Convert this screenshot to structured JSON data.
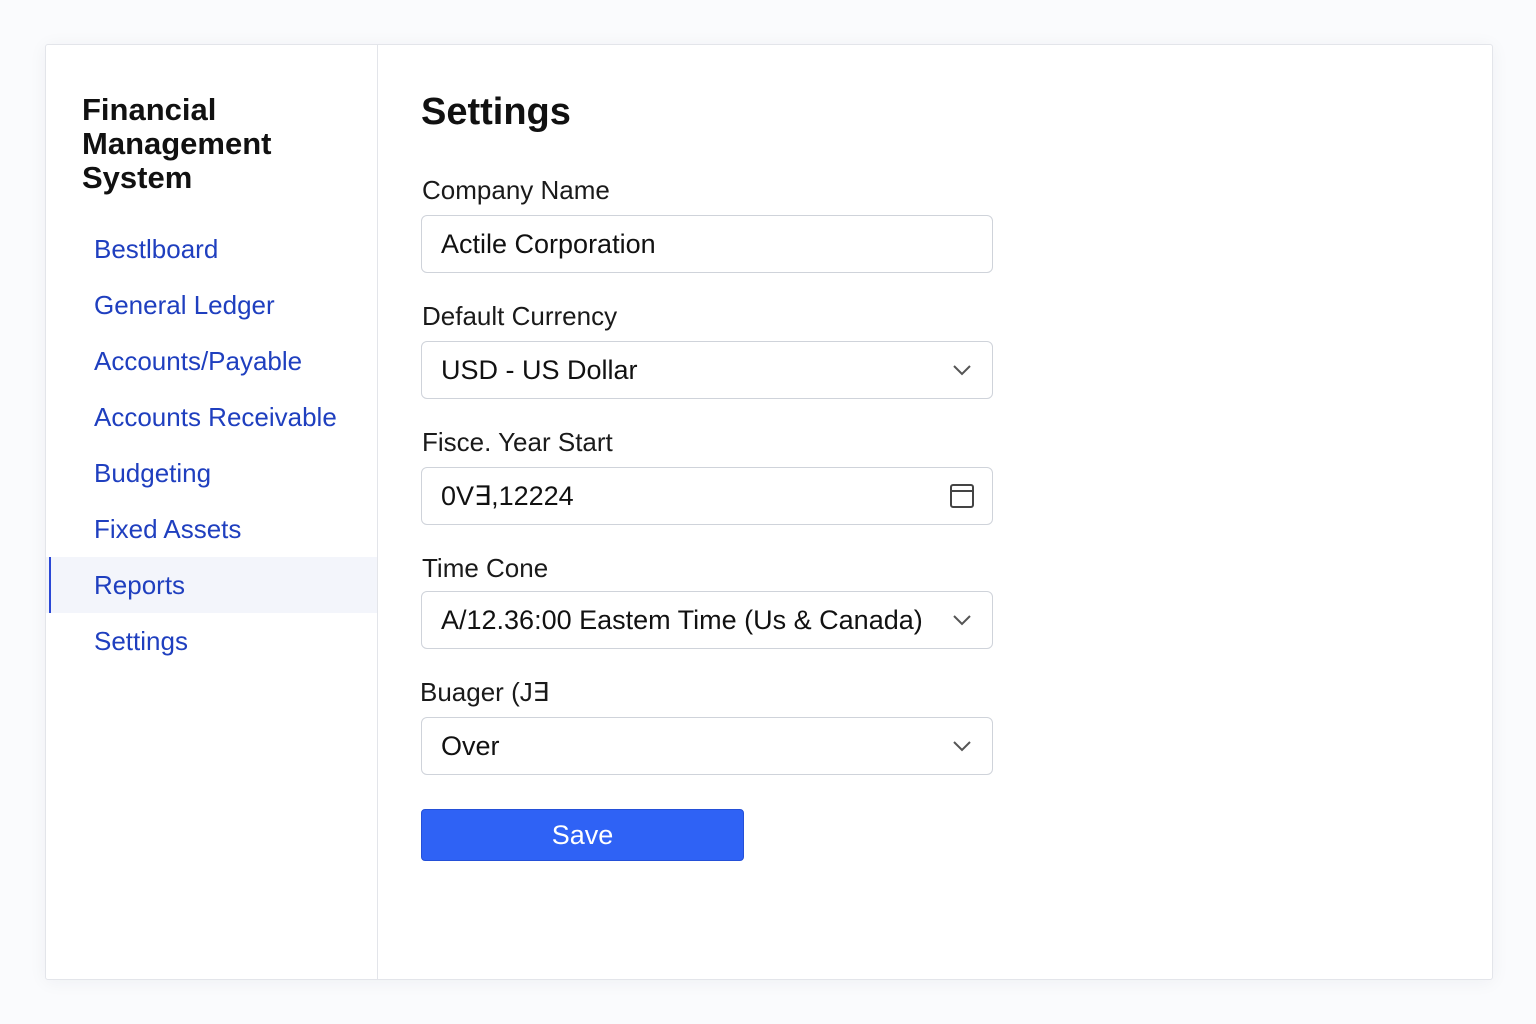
{
  "app": {
    "title": "Financial Management System"
  },
  "sidebar": {
    "items": [
      {
        "label": "Bestlboard"
      },
      {
        "label": "General Ledger"
      },
      {
        "label": "Accounts/Payable"
      },
      {
        "label": "Accounts Receivable"
      },
      {
        "label": "Budgeting"
      },
      {
        "label": "Fixed Assets"
      },
      {
        "label": "Reports",
        "active": true
      },
      {
        "label": "Settings"
      }
    ]
  },
  "main": {
    "title": "Settings",
    "fields": {
      "company_name": {
        "label": "Company Name",
        "value": "Actile Corporation"
      },
      "currency": {
        "label": "Default Currency",
        "value": "USD - US Dollar",
        "icon": "chevron-down-icon"
      },
      "fiscal_year_start": {
        "label": "Fisce. Year Start",
        "value": "0V∃,12224",
        "icon": "calendar-icon"
      },
      "time_zone": {
        "label": "Time Cone",
        "value": "A/12.36:00 Eastem Time (Us & Canada)",
        "icon": "chevron-down-icon"
      },
      "budget": {
        "label": "Buager (J∃",
        "value": "Over",
        "icon": "chevron-down-icon"
      }
    },
    "save_label": "Save"
  },
  "colors": {
    "accent": "#2f62f5",
    "nav_link": "#1f3fbf",
    "active_bg": "#f3f5fb",
    "border": "#cfd3da"
  }
}
